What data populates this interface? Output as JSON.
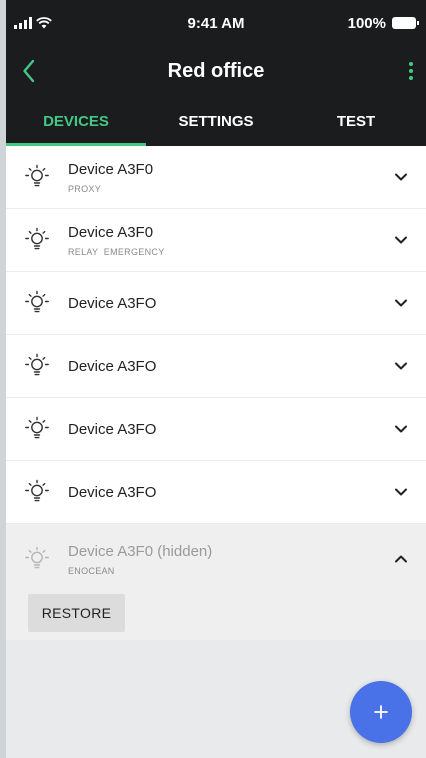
{
  "status": {
    "time": "9:41 AM",
    "battery": "100%"
  },
  "header": {
    "title": "Red office"
  },
  "tabs": [
    {
      "label": "DEVICES",
      "active": true
    },
    {
      "label": "SETTINGS",
      "active": false
    },
    {
      "label": "TEST",
      "active": false
    }
  ],
  "devices": [
    {
      "name": "Device A3F0",
      "subtitle": "PROXY"
    },
    {
      "name": "Device A3F0",
      "subtitle": "RELAY  EMERGENCY"
    },
    {
      "name": "Device A3FO",
      "subtitle": ""
    },
    {
      "name": "Device A3FO",
      "subtitle": ""
    },
    {
      "name": "Device A3FO",
      "subtitle": ""
    },
    {
      "name": "Device A3FO",
      "subtitle": ""
    },
    {
      "name": "Device A3F0 (hidden)",
      "subtitle": "ENOCEAN",
      "hidden": true
    }
  ],
  "restore_label": "RESTORE",
  "colors": {
    "accent": "#43c983",
    "fab": "#4a72e8",
    "bar": "#1a1c1e"
  },
  "icons": [
    "chevron-left-icon",
    "more-vert-icon",
    "bulb-icon",
    "chevron-down-icon",
    "chevron-up-icon",
    "plus-icon"
  ]
}
